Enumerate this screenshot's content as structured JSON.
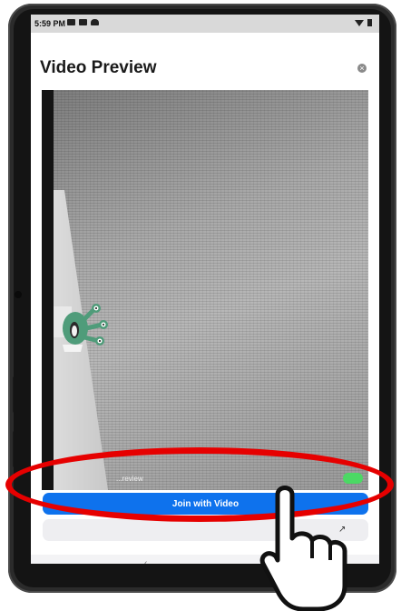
{
  "status_bar": {
    "time": "5:59 PM",
    "icons_left": [
      "image-icon",
      "video-icon",
      "cloud-icon"
    ],
    "icons_right": [
      "wifi-icon",
      "battery-icon"
    ]
  },
  "dialog": {
    "title": "Video Preview",
    "close_icon": "close-icon",
    "preview_caption": "...review",
    "join_button_label": "Join with Video",
    "secondary_arrow": "↗"
  },
  "nav": {
    "back_glyph": "‹"
  },
  "overlay": {
    "highlight_color": "#e60000",
    "pointer_icon": "pointer-hand-icon"
  },
  "colors": {
    "primary": "#0e72ed",
    "toggle_on": "#4bd964"
  }
}
